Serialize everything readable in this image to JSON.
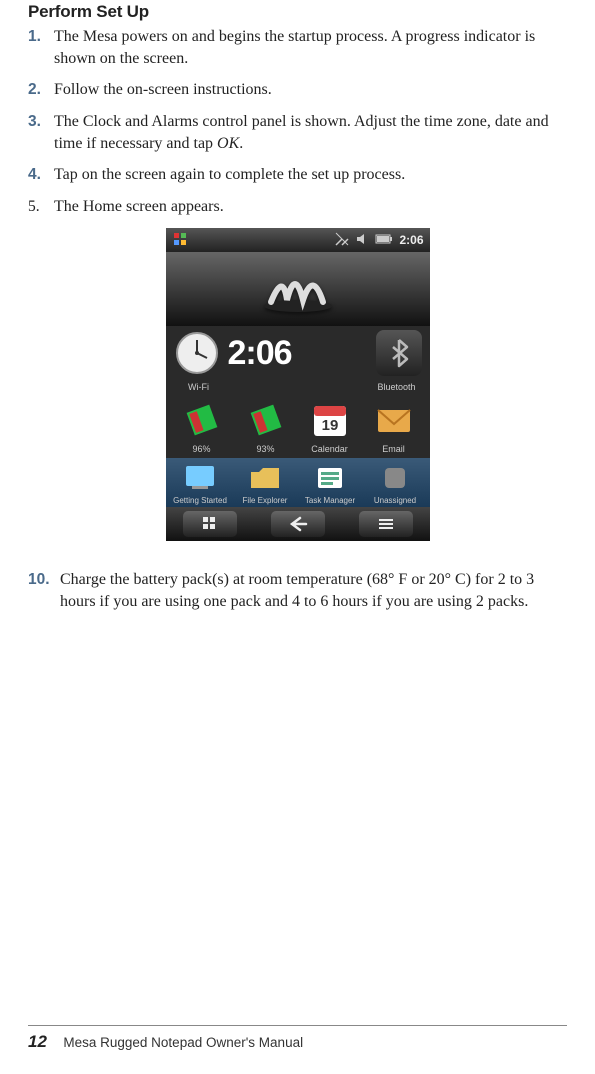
{
  "section_title": "Perform Set Up",
  "steps": [
    {
      "num": "1.",
      "bold": true,
      "text": "The Mesa powers on and begins the startup process. A progress indicator is shown on the screen."
    },
    {
      "num": "2.",
      "bold": true,
      "text": "Follow the on-screen instructions."
    },
    {
      "num": "3.",
      "bold": true,
      "text_pre": "The Clock and Alarms control panel is shown. Adjust the time zone, date and time if necessary and tap ",
      "text_em": "OK",
      "text_post": "."
    },
    {
      "num": "4.",
      "bold": true,
      "text": "Tap on the screen again to complete the set up process."
    },
    {
      "num": "5.",
      "bold": false,
      "text": "The Home screen appears."
    }
  ],
  "step10": {
    "num": "10.",
    "text": "Charge the battery pack(s) at room temperature (68° F or 20° C) for 2 to 3 hours if you are using one pack and 4 to 6 hours if you are using 2 packs."
  },
  "figure": {
    "status_time": "2:06",
    "clock_digital": "2:06",
    "wifi_label": "Wi-Fi",
    "bluetooth_label": "Bluetooth",
    "row2": [
      {
        "label": "96%",
        "icon": "battery-red-icon"
      },
      {
        "label": "93%",
        "icon": "battery-green-icon"
      },
      {
        "label": "Calendar",
        "icon": "calendar-icon"
      },
      {
        "label": "Email",
        "icon": "email-icon"
      }
    ],
    "dock": [
      {
        "label": "Getting Started",
        "icon": "getting-started-icon"
      },
      {
        "label": "File Explorer",
        "icon": "file-explorer-icon"
      },
      {
        "label": "Task Manager",
        "icon": "task-manager-icon"
      },
      {
        "label": "Unassigned",
        "icon": "unassigned-icon"
      }
    ],
    "calendar_day": "19"
  },
  "footer": {
    "page_number": "12",
    "doc_title": "Mesa Rugged Notepad Owner's Manual"
  }
}
